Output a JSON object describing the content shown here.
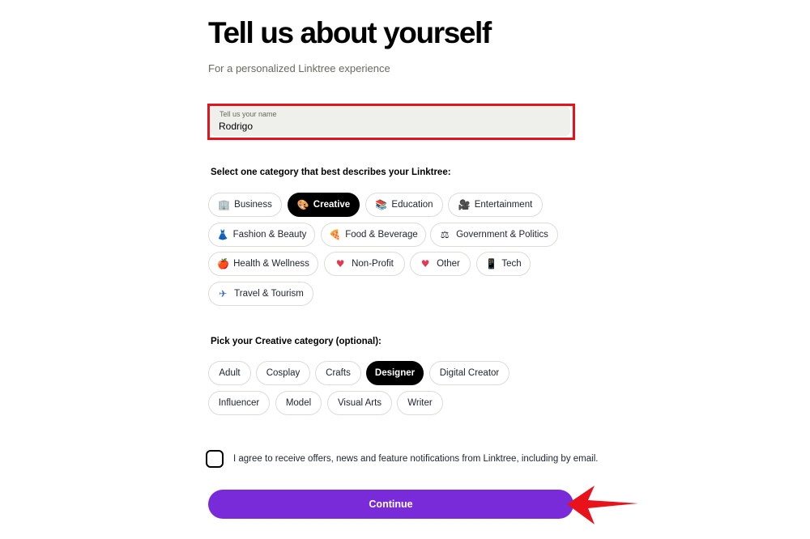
{
  "header": {
    "title": "Tell us about yourself",
    "subtitle": "For a personalized Linktree experience"
  },
  "name_field": {
    "label": "Tell us your name",
    "value": "Rodrigo"
  },
  "categories": {
    "label": "Select one category that best describes your Linktree:",
    "selected": "Creative",
    "items": [
      {
        "label": "Business",
        "icon": "office-building-icon",
        "glyph": "🏢"
      },
      {
        "label": "Creative",
        "icon": "palette-icon",
        "glyph": "🎨"
      },
      {
        "label": "Education",
        "icon": "books-icon",
        "glyph": "📚"
      },
      {
        "label": "Entertainment",
        "icon": "film-camera-icon",
        "glyph": "🎥"
      },
      {
        "label": "Fashion & Beauty",
        "icon": "dress-icon",
        "glyph": "👗"
      },
      {
        "label": "Food & Beverage",
        "icon": "pizza-icon",
        "glyph": "🍕"
      },
      {
        "label": "Government & Politics",
        "icon": "scales-icon",
        "glyph": "⚖"
      },
      {
        "label": "Health & Wellness",
        "icon": "apple-icon",
        "glyph": "🍎"
      },
      {
        "label": "Non-Profit",
        "icon": "heart-icon",
        "glyph": "♥"
      },
      {
        "label": "Other",
        "icon": "heart-icon",
        "glyph": "♥"
      },
      {
        "label": "Tech",
        "icon": "phone-icon",
        "glyph": "📱"
      },
      {
        "label": "Travel & Tourism",
        "icon": "airplane-icon",
        "glyph": "✈"
      }
    ]
  },
  "subcategories": {
    "label": "Pick your Creative category (optional):",
    "selected": "Designer",
    "items": [
      "Adult",
      "Cosplay",
      "Crafts",
      "Designer",
      "Digital Creator",
      "Influencer",
      "Model",
      "Visual Arts",
      "Writer"
    ]
  },
  "consent": {
    "label": "I agree to receive offers, news and feature notifications from Linktree, including by email.",
    "checked": false
  },
  "continue_label": "Continue",
  "colors": {
    "accent": "#7a2bd9",
    "highlight": "#e8121b",
    "selected_pill": "#000000",
    "field_bg": "#efefeb"
  }
}
